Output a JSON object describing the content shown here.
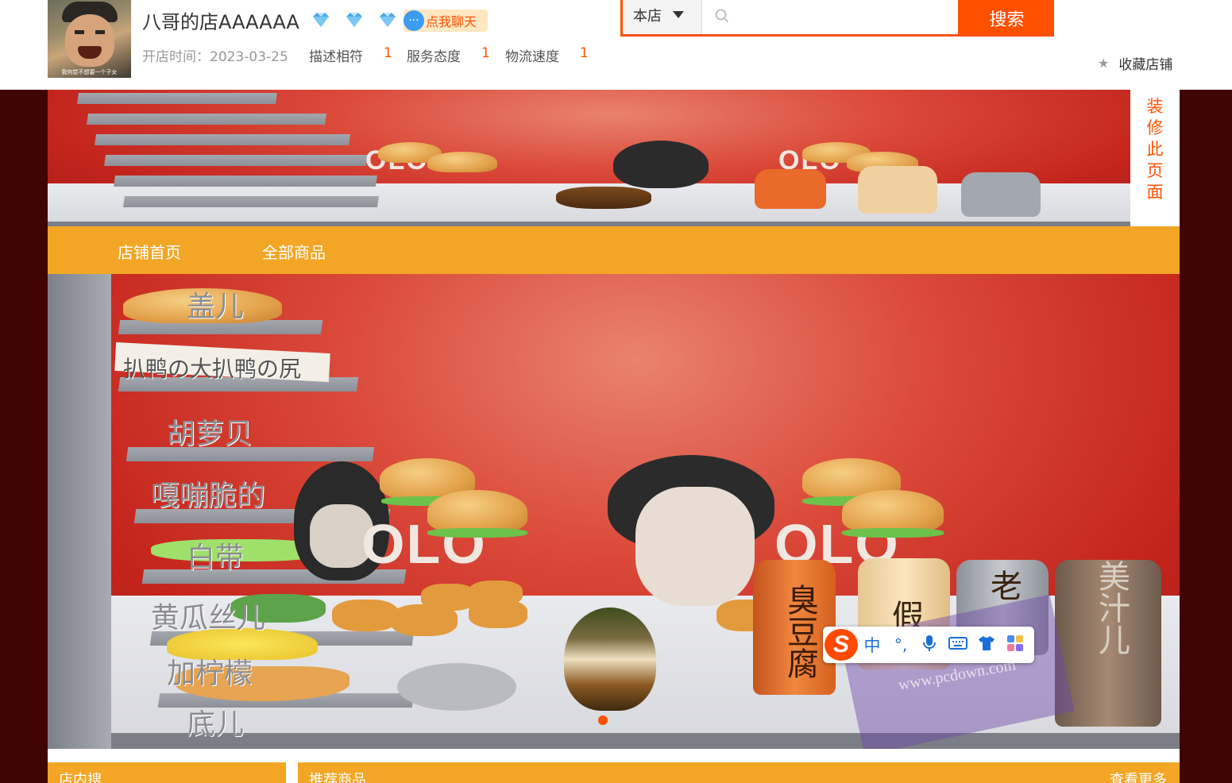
{
  "header": {
    "shop_name": "八哥的店AAAAAA",
    "avatar_caption": "我何尝不想要一个子女",
    "chat_label": "点我聊天",
    "open_time_label": "开店时间：",
    "open_time_value": "2023-03-25",
    "ratings": [
      {
        "label": "描述相符",
        "value": "1"
      },
      {
        "label": "服务态度",
        "value": "1"
      },
      {
        "label": "物流速度",
        "value": "1"
      }
    ],
    "diamond_icon_count": 3,
    "favorite_label": "收藏店铺"
  },
  "search": {
    "scope_label": "本店",
    "placeholder": "",
    "button_label": "搜索"
  },
  "decorate_label": "装修此页面",
  "nav": {
    "items": [
      "店铺首页",
      "全部商品"
    ]
  },
  "scene_labels": {
    "shelves": [
      "盖儿",
      "扒鸭の大扒鸭の尻",
      "胡萝贝",
      "嘎嘣脆的",
      "白带",
      "黄瓜丝儿",
      "加柠檬",
      "底儿"
    ],
    "bottles": [
      "臭豆腐",
      "假奶",
      "老",
      "美汁儿"
    ],
    "poster_text": "OLO",
    "watermark": "www.pcdown.com"
  },
  "carousel": {
    "active_slide": 1,
    "slide_count": 1
  },
  "ime": {
    "items": [
      "中",
      "°,",
      "mic-icon",
      "keyboard-icon",
      "shirt-icon",
      "grid-icon"
    ]
  },
  "panels": {
    "left_title": "店内搜",
    "right_title": "推荐商品",
    "more_label": "查看更多"
  },
  "colors": {
    "accent": "#ff5000",
    "nav_bg": "#f3a626",
    "page_bg": "#410405"
  }
}
